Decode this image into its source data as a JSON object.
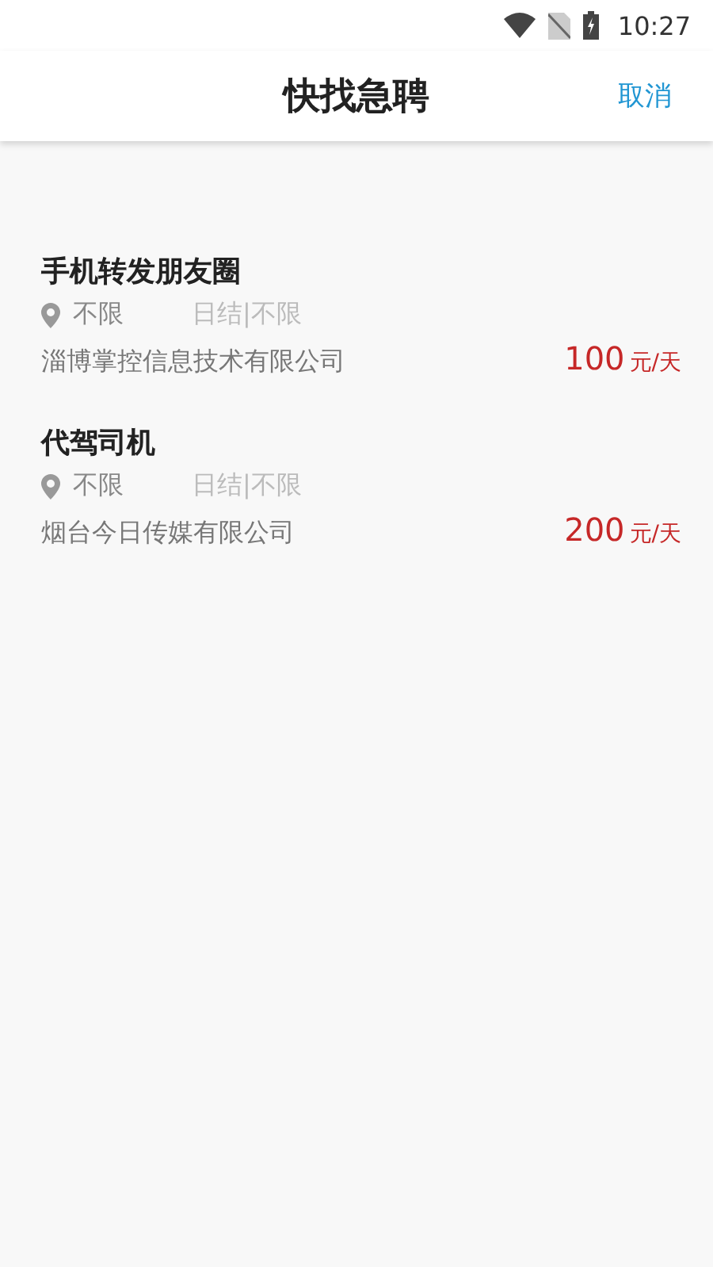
{
  "status_bar": {
    "time": "10:27"
  },
  "header": {
    "title": "快找急聘",
    "cancel": "取消"
  },
  "jobs": [
    {
      "title": "手机转发朋友圈",
      "location": "不限",
      "settlement": "日结|不限",
      "company": "淄博掌控信息技术有限公司",
      "pay": "100",
      "unit": "元/天"
    },
    {
      "title": "代驾司机",
      "location": "不限",
      "settlement": "日结|不限",
      "company": "烟台今日传媒有限公司",
      "pay": "200",
      "unit": "元/天"
    }
  ]
}
